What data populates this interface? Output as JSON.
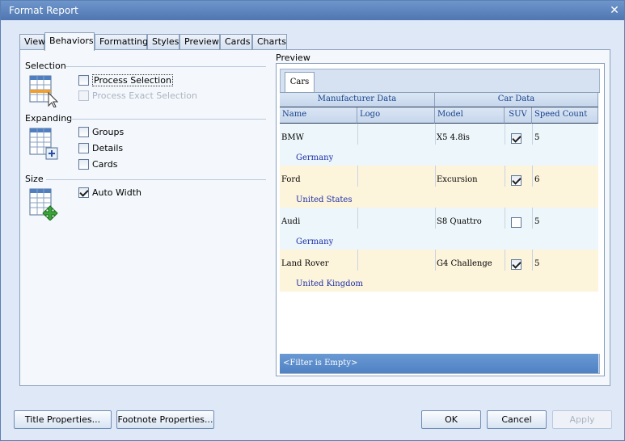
{
  "window": {
    "title": "Format Report",
    "close_glyph": "✕"
  },
  "tabs": [
    {
      "label": "View"
    },
    {
      "label": "Behaviors",
      "active": true
    },
    {
      "label": "Formatting"
    },
    {
      "label": "Styles"
    },
    {
      "label": "Preview"
    },
    {
      "label": "Cards"
    },
    {
      "label": "Charts"
    }
  ],
  "selection": {
    "label": "Selection",
    "process_selection": {
      "label": "Process Selection",
      "checked": false
    },
    "process_exact_selection": {
      "label": "Process Exact Selection",
      "checked": false,
      "disabled": true
    }
  },
  "expanding": {
    "label": "Expanding",
    "groups": {
      "label": "Groups",
      "checked": false
    },
    "details": {
      "label": "Details",
      "checked": false
    },
    "cards": {
      "label": "Cards",
      "checked": false
    }
  },
  "size": {
    "label": "Size",
    "auto_width": {
      "label": "Auto Width",
      "checked": true
    }
  },
  "preview": {
    "label": "Preview",
    "grid_tab": "Cars",
    "band_manufacturer": "Manufacturer Data",
    "band_car": "Car Data",
    "columns": {
      "name": "Name",
      "logo": "Logo",
      "model": "Model",
      "suv": "SUV",
      "speed": "Speed Count"
    },
    "rows": [
      {
        "name": "BMW",
        "model": "X5 4.8is",
        "suv": true,
        "speed": "5",
        "country": "Germany"
      },
      {
        "name": "Ford",
        "model": "Excursion",
        "suv": true,
        "speed": "6",
        "country": "United States"
      },
      {
        "name": "Audi",
        "model": "S8 Quattro",
        "suv": false,
        "speed": "5",
        "country": "Germany"
      },
      {
        "name": "Land Rover",
        "model": "G4 Challenge",
        "suv": true,
        "speed": "5",
        "country": "United Kingdom"
      }
    ],
    "filter_text": "<Filter is Empty>"
  },
  "buttons": {
    "title_properties": "Title Properties...",
    "footnote_properties": "Footnote Properties...",
    "ok": "OK",
    "cancel": "Cancel",
    "apply": "Apply"
  },
  "colors": {
    "row_odd": "#edf6fa",
    "row_even": "#fdf4dc",
    "country_text": "#1c2fa8"
  }
}
